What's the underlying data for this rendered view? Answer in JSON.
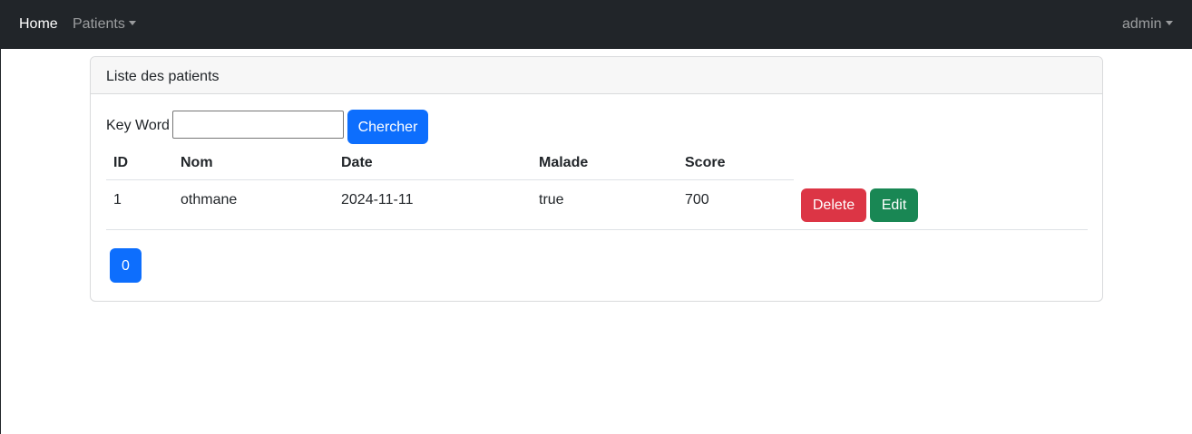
{
  "navbar": {
    "home_label": "Home",
    "patients_label": "Patients",
    "user_label": "admin"
  },
  "card": {
    "title": "Liste des patients"
  },
  "search": {
    "label": "Key Word",
    "value": "",
    "placeholder": "",
    "button_label": "Chercher"
  },
  "table": {
    "headers": [
      "ID",
      "Nom",
      "Date",
      "Malade",
      "Score"
    ],
    "rows": [
      {
        "id": "1",
        "nom": "othmane",
        "date": "2024-11-11",
        "malade": "true",
        "score": "700",
        "delete_label": "Delete",
        "edit_label": "Edit"
      }
    ]
  },
  "pagination": {
    "pages": [
      "0"
    ],
    "current": "0"
  },
  "colors": {
    "navbar": "#212529",
    "primary": "#0d6efd",
    "danger": "#dc3545",
    "success": "#198754"
  },
  "icons": {
    "patients_dropdown": "chevron-down-icon",
    "user_dropdown": "chevron-down-icon"
  }
}
